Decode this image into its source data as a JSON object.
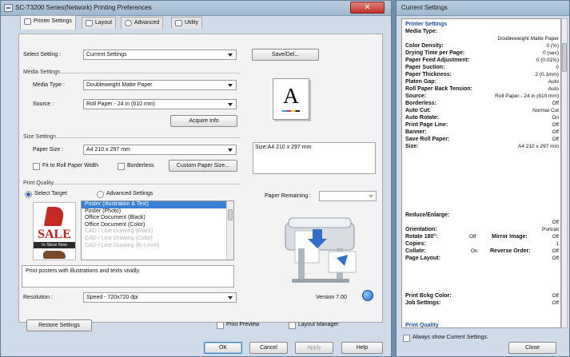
{
  "main_window": {
    "title": "SC-T3200 Series(Network) Printing Preferences",
    "close_glyph": "✕",
    "tabs": [
      "Printer Settings",
      "Layout",
      "Advanced",
      "Utility"
    ],
    "select_setting": {
      "label": "Select Setting :",
      "value": "Current Settings",
      "save_button": "Save/Del..."
    },
    "media_settings": {
      "heading": "Media Settings",
      "media_type_label": "Media Type :",
      "media_type_value": "Doubleweight Matte Paper",
      "source_label": "Source :",
      "source_value": "Roll Paper - 24 in (610 mm)",
      "acquire_button": "Acquire Info"
    },
    "preview_letter": "A",
    "size_settings": {
      "heading": "Size Settings",
      "paper_size_label": "Paper Size :",
      "paper_size_value": "A4 210 x 297 mm",
      "fit_width_label": "Fit to Roll Paper Width",
      "borderless_label": "Borderless",
      "custom_button": "Custom Paper Size...",
      "size_summary": "Size:A4 210 x 297 mm"
    },
    "print_quality": {
      "heading": "Print Quality",
      "select_target_label": "Select Target",
      "advanced_label": "Advanced Settings",
      "ad_text": "SALE",
      "ad_banner": "In Store Now",
      "list_items": [
        {
          "text": "Poster (Illustration & Text)",
          "state": "selected"
        },
        {
          "text": "Poster (Photo)",
          "state": "normal"
        },
        {
          "text": "Office Document (Black)",
          "state": "normal"
        },
        {
          "text": "Office Document (Color)",
          "state": "normal"
        },
        {
          "text": "CAD / Line Drawing (Black)",
          "state": "dim"
        },
        {
          "text": "CAD / Line Drawing (Color)",
          "state": "dim"
        },
        {
          "text": "CAD / Line Drawing (Bi-Level)",
          "state": "dim"
        }
      ],
      "description": "Print posters with illustrations and texts vividly.",
      "resolution_label": "Resolution :",
      "resolution_value": "Speed - 720x720 dpi"
    },
    "paper_remaining_label": "Paper Remaining :",
    "version": "Version 7.00",
    "restore_button": "Restore Settings",
    "print_preview_label": "Print Preview",
    "layout_manager_label": "Layout Manager",
    "ok_button": "OK",
    "cancel_button": "Cancel",
    "apply_button": "Apply",
    "help_button": "Help"
  },
  "side_window": {
    "title": "Current Settings",
    "section_printer": "Printer Settings",
    "media_type_key": "Media Type:",
    "media_type_value": "Doubleweight Matte Paper",
    "rows": [
      {
        "k": "Color Density:",
        "v": "0 (%)"
      },
      {
        "k": "Drying Time per Page:",
        "v": "0 (sec)"
      },
      {
        "k": "Paper Feed Adjustment:",
        "v": "0 (0.01%)"
      },
      {
        "k": "Paper Suction:",
        "v": "0"
      },
      {
        "k": "Paper Thickness:",
        "v": "2 (0.1mm)"
      },
      {
        "k": "Platen Gap:",
        "v": "Auto"
      },
      {
        "k": "Roll Paper Back Tension:",
        "v": "Auto"
      },
      {
        "k": "Source:",
        "v": "Roll Paper - 24 in (610 mm)"
      },
      {
        "k": "Borderless:",
        "v": "Off"
      },
      {
        "k": "Auto Cut:",
        "v": "Normal Cut"
      },
      {
        "k": "Auto Rotate:",
        "v": "On"
      },
      {
        "k": "Print Page Line:",
        "v": "Off"
      },
      {
        "k": "Banner:",
        "v": "Off"
      },
      {
        "k": "Save Roll Paper:",
        "v": "Off"
      },
      {
        "k": "Size:",
        "v": "A4 210 x 297 mm"
      }
    ],
    "reduce_key": "Reduce/Enlarge:",
    "reduce_value": "Off",
    "orientation_key": "Orientation:",
    "orientation_value": "Portrait",
    "rotate_key": "Rotate 180°:",
    "rotate_value": "Off",
    "mirror_key": "Mirror Image:",
    "mirror_value": "Off",
    "copies_key": "Copies:",
    "copies_value": "1",
    "collate_key": "Collate:",
    "collate_value": "On",
    "reverse_key": "Reverse Order:",
    "reverse_value": "Off",
    "page_layout_key": "Page Layout:",
    "page_layout_value": "Off",
    "bckg_key": "Print Bckg Color:",
    "bckg_value": "Off",
    "job_key": "Job Settings:",
    "job_value": "Off",
    "section_quality": "Print Quality",
    "always_show_label": "Always show Current Settings.",
    "close_button": "Close"
  }
}
